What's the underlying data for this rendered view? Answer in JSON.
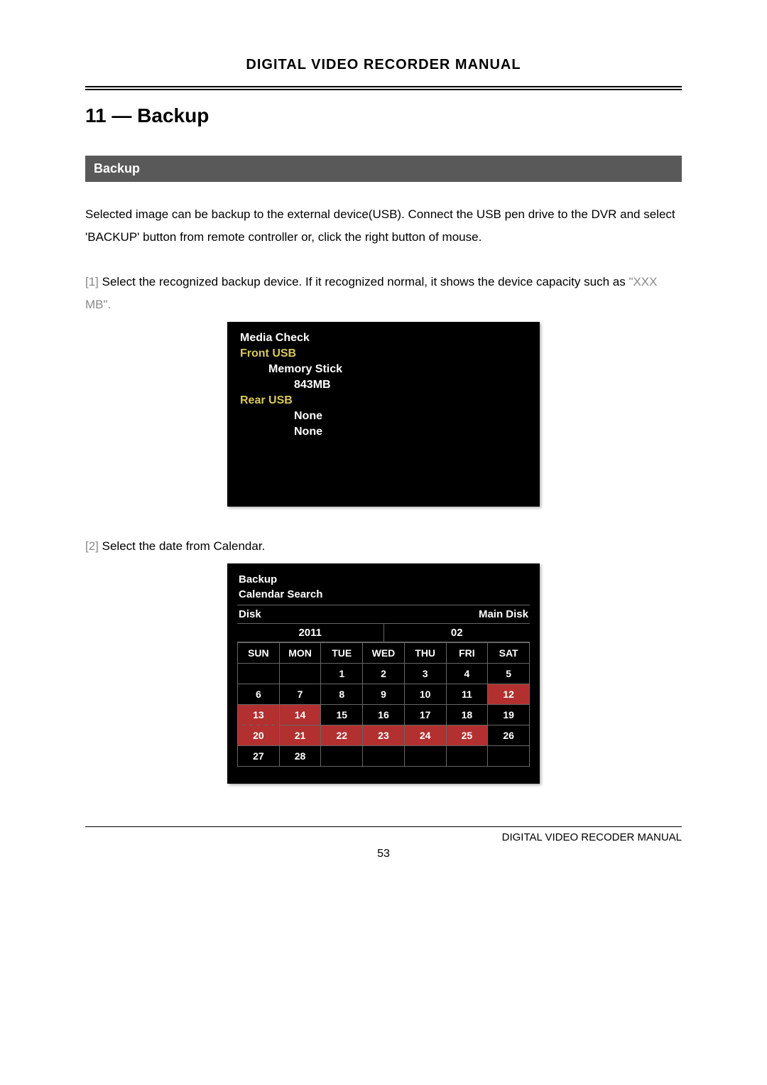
{
  "header_title": "DIGITAL VIDEO RECORDER MANUAL",
  "chapter_label": "11 — Backup",
  "section_label": "Backup",
  "intro_text": "Selected image can be backup to the external device(USB). Connect the USB pen drive to the DVR and select 'BACKUP' button from remote controller or, click the right button of mouse.",
  "step1_prefix": "[1]",
  "step1_text": "Select the recognized backup device. If it recognized normal, it shows the device capacity such as",
  "step1_gray": "\"XXX MB\".",
  "media_check": {
    "title": "Media Check",
    "front_label": "Front USB",
    "front_line1": "Memory Stick",
    "front_line2": "843MB",
    "rear_label": "Rear USB",
    "rear_line1": "None",
    "rear_line2": "None"
  },
  "step2_prefix": "[2]",
  "step2_text": "Select the date from Calendar.",
  "calendar": {
    "heading1": "Backup",
    "heading2": "Calendar Search",
    "disk_label": "Disk",
    "disk_value": "Main Disk",
    "year": "2011",
    "month": "02",
    "days": [
      "SUN",
      "MON",
      "TUE",
      "WED",
      "THU",
      "FRI",
      "SAT"
    ],
    "rows": [
      [
        "",
        "1",
        "2",
        "3",
        "4",
        "5"
      ],
      [
        "6",
        "7",
        "8",
        "9",
        "10",
        "11",
        "12"
      ],
      [
        "13",
        "14",
        "15",
        "16",
        "17",
        "18",
        "19"
      ],
      [
        "20",
        "21",
        "22",
        "23",
        "24",
        "25",
        "26"
      ],
      [
        "27",
        "28",
        "",
        "",
        "",
        "",
        ""
      ]
    ],
    "highlighted": [
      "12",
      "13",
      "14",
      "20",
      "21",
      "22",
      "23",
      "24",
      "25"
    ],
    "selected": "13"
  },
  "footer_text": "DIGITAL VIDEO RECODER MANUAL",
  "page_number": "53"
}
